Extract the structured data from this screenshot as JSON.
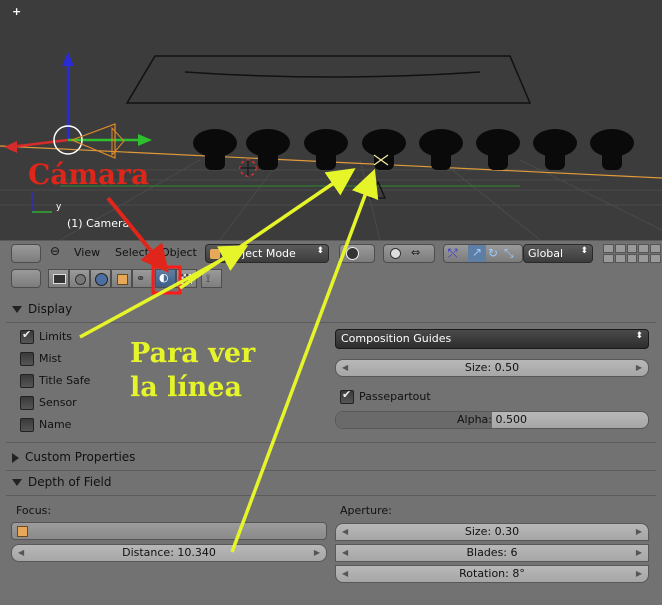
{
  "viewport": {
    "object_label": "(1) Camera",
    "axis_label": "y",
    "plus": "+"
  },
  "header": {
    "view": "View",
    "select": "Select",
    "object": "Object",
    "mode": "Object Mode",
    "orientation": "Global",
    "icons": [
      "editor-type-icon",
      "menu-collapse-icon",
      "viewport-shading-icon",
      "pivot-icon",
      "manipulator-icon",
      "layers-grid"
    ]
  },
  "property_tabs": [
    "render-tab",
    "scene-tab",
    "world-tab",
    "object-tab",
    "constraints-tab",
    "camera-data-tab",
    "texture-tab",
    "particles-tab"
  ],
  "display_panel": {
    "title": "Display",
    "checkboxes": [
      {
        "label": "Limits",
        "checked": true
      },
      {
        "label": "Mist",
        "checked": false
      },
      {
        "label": "Title Safe",
        "checked": false
      },
      {
        "label": "Sensor",
        "checked": false
      },
      {
        "label": "Name",
        "checked": false
      }
    ],
    "composition": "Composition Guides",
    "size": "Size: 0.50",
    "passepartout": {
      "label": "Passepartout",
      "checked": true
    },
    "alpha": "Alpha: 0.500",
    "alpha_fill": 0.5
  },
  "custom_properties": {
    "title": "Custom Properties"
  },
  "dof_panel": {
    "title": "Depth of Field",
    "focus_label": "Focus:",
    "distance": "Distance: 10.340",
    "aperture_label": "Aperture:",
    "aperture_size": "Size: 0.30",
    "blades": "Blades: 6",
    "rotation": "Rotation: 8°"
  },
  "annotations": {
    "camera": "Cámara",
    "line1": "Para ver",
    "line2": "la línea"
  },
  "colors": {
    "annotation_red": "#e0261a",
    "annotation_yellow": "#e6f52a",
    "highlight_red": "#ff1a1a"
  }
}
